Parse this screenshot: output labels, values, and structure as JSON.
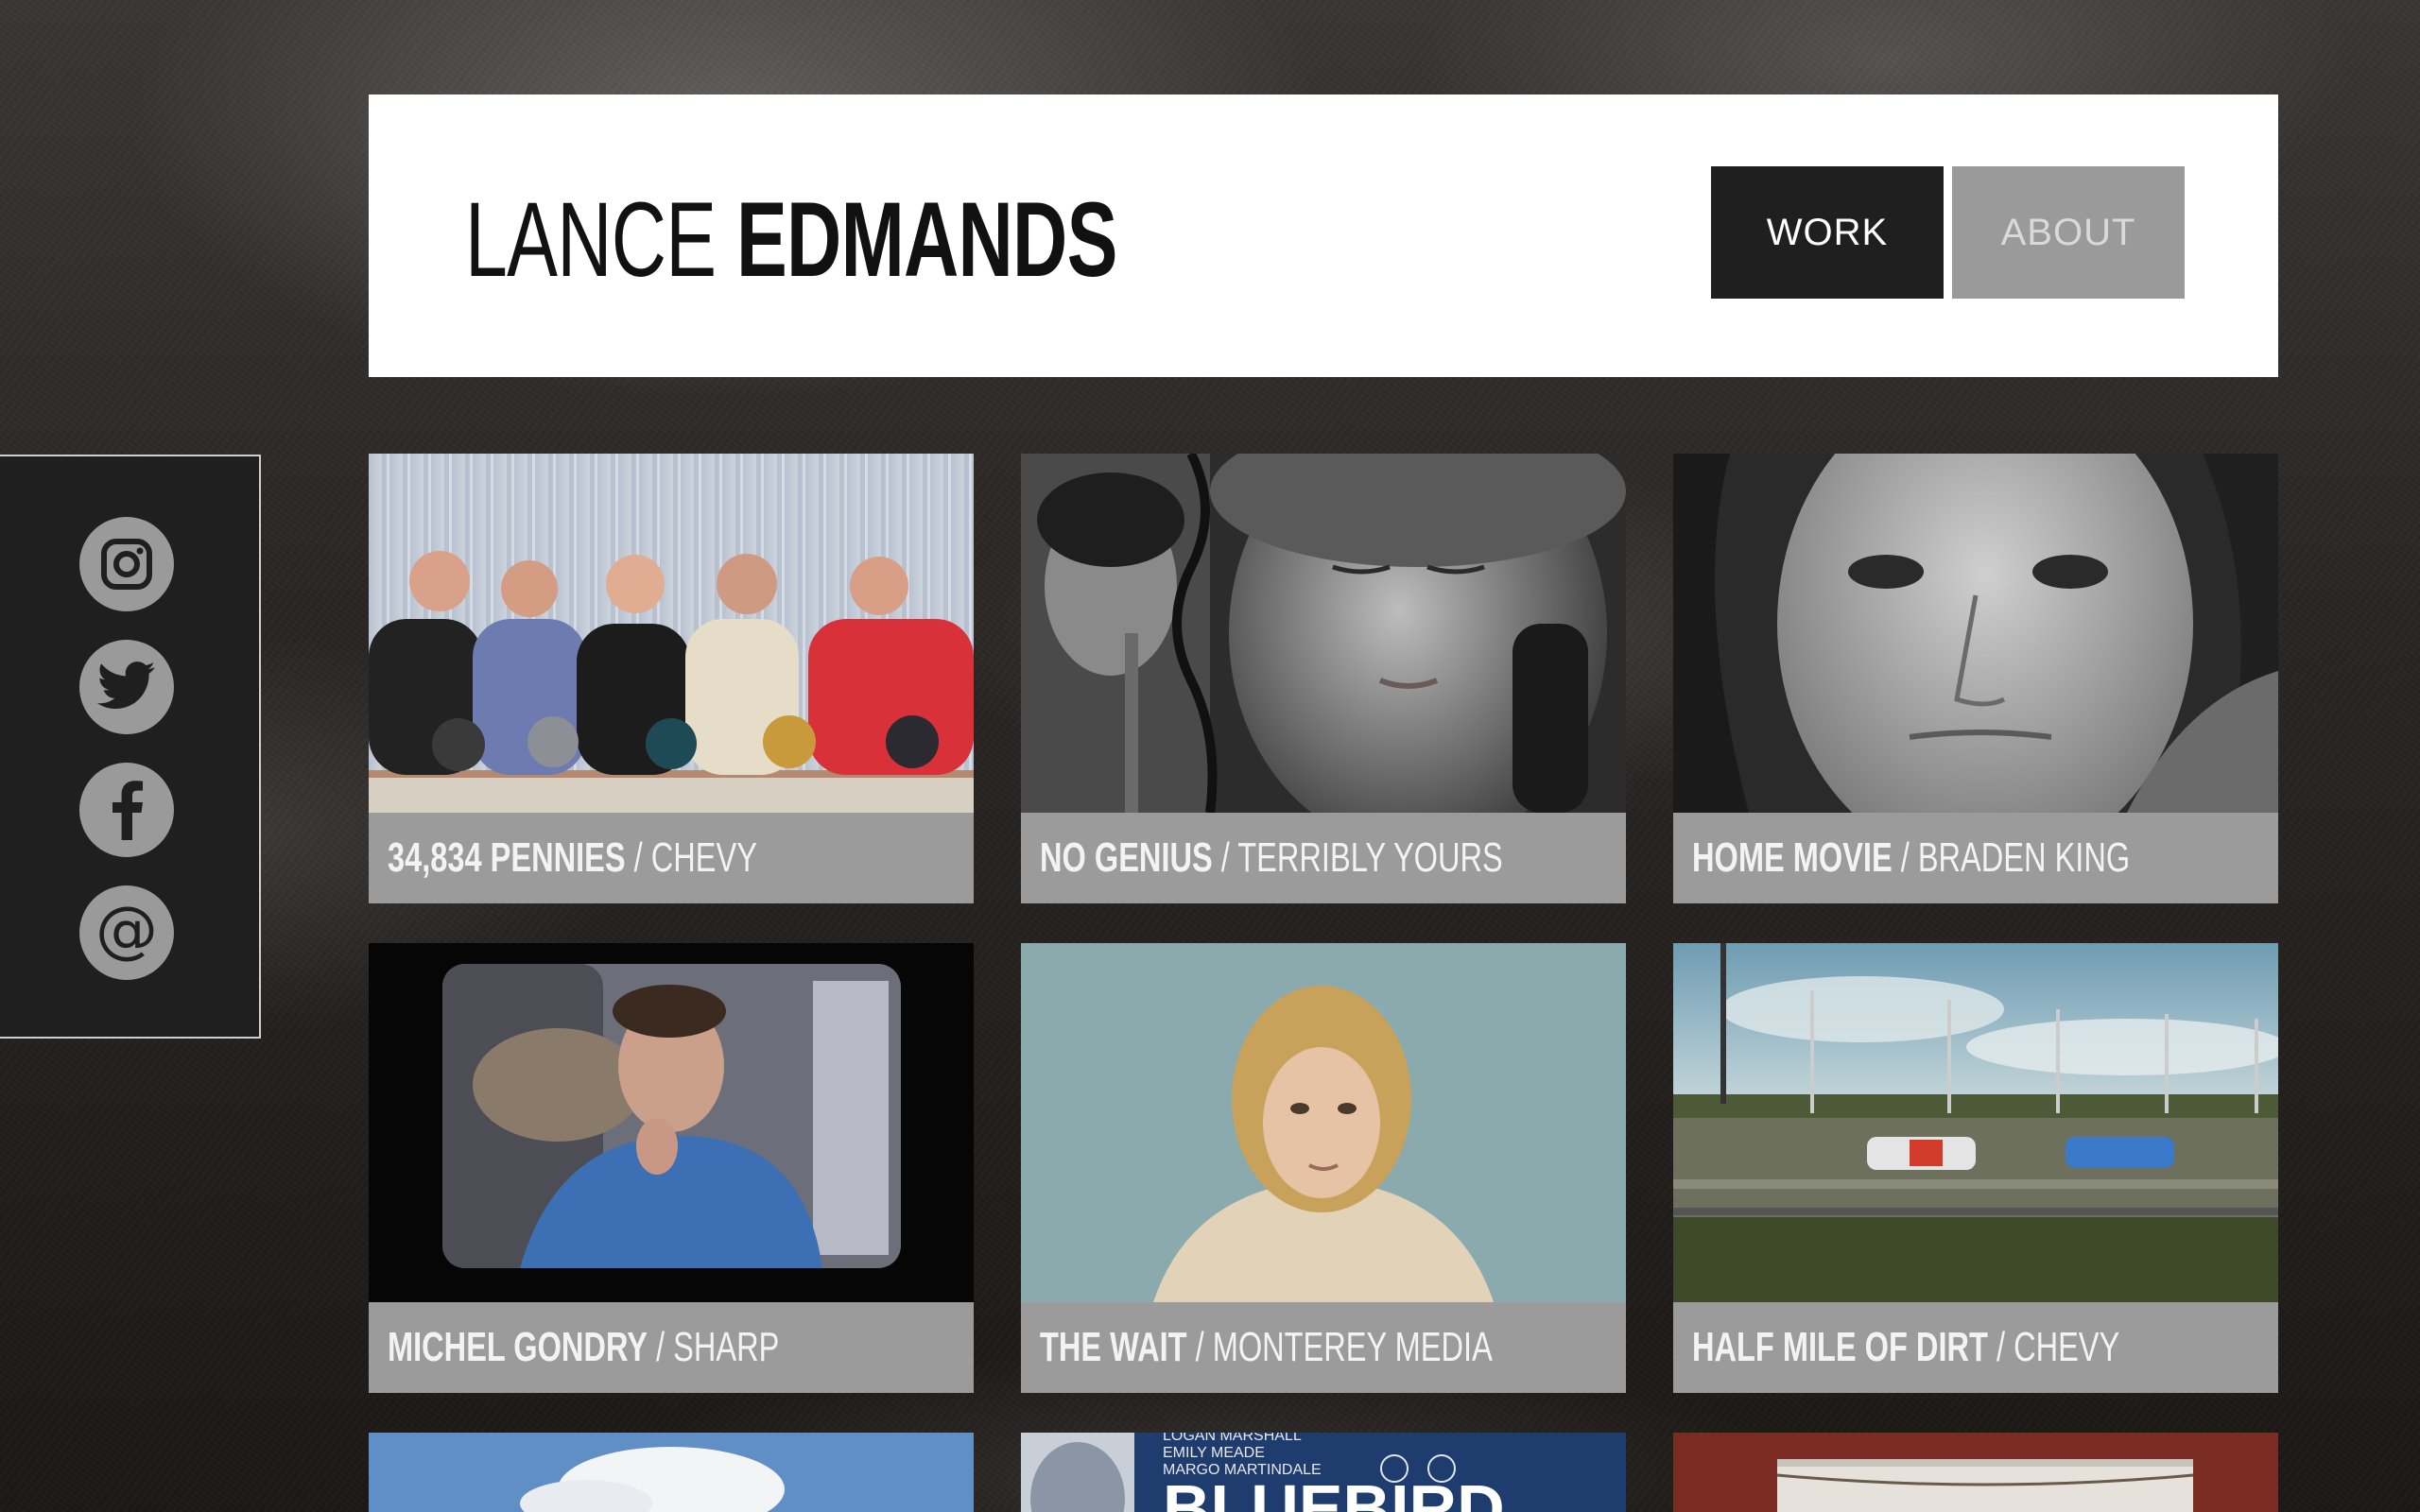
{
  "site": {
    "logo_first": "LANCE",
    "logo_last": "EDMANDS"
  },
  "nav": {
    "work_label": "WORK",
    "about_label": "ABOUT"
  },
  "social": [
    {
      "icon": "instagram-icon"
    },
    {
      "icon": "twitter-icon"
    },
    {
      "icon": "facebook-icon"
    },
    {
      "icon": "email-icon",
      "glyph": "@"
    }
  ],
  "separator": "/",
  "projects": [
    {
      "title": "34,834 PENNIES",
      "client": "CHEVY"
    },
    {
      "title": "NO GENIUS",
      "client": "TERRIBLY YOURS"
    },
    {
      "title": "HOME MOVIE",
      "client": "BRADEN KING"
    },
    {
      "title": "MICHEL GONDRY",
      "client": "SHARP"
    },
    {
      "title": "THE WAIT",
      "client": "MONTEREY MEDIA"
    },
    {
      "title": "HALF MILE OF DIRT",
      "client": "CHEVY"
    }
  ],
  "poster_text": {
    "line1": "LOGAN MARSHALL",
    "line2": "EMILY MEADE",
    "line3": "MARGO MARTINDALE",
    "title": "BLUEBIRD"
  },
  "colors": {
    "header_bg": "#ffffff",
    "nav_active": "#1f1f1f",
    "nav_inactive": "#9a9a9a",
    "caption_bg": "#9b9b9b",
    "sidebar_bg": "#1f1f1f"
  }
}
